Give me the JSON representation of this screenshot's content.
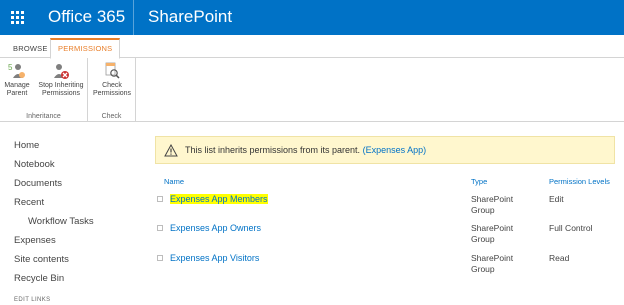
{
  "suite": {
    "brand": "Office 365",
    "app": "SharePoint",
    "icons": {
      "waffle": "app-launcher-icon"
    },
    "color": "#0072c6"
  },
  "ribbon": {
    "tabs": [
      {
        "label": "BROWSE"
      },
      {
        "label": "PERMISSIONS",
        "active": true
      }
    ],
    "accent": "#e97f2a",
    "groups": [
      {
        "label": "Inheritance",
        "buttons": [
          {
            "line1": "Manage",
            "line2": "Parent",
            "icon": "manage-parent-icon"
          },
          {
            "line1": "Stop Inheriting",
            "line2": "Permissions",
            "icon": "stop-inheriting-icon"
          }
        ]
      },
      {
        "label": "Check",
        "buttons": [
          {
            "line1": "Check",
            "line2": "Permissions",
            "icon": "check-permissions-icon"
          }
        ]
      }
    ]
  },
  "leftnav": {
    "items": [
      {
        "label": "Home"
      },
      {
        "label": "Notebook"
      },
      {
        "label": "Documents"
      },
      {
        "label": "Recent"
      },
      {
        "label": "Workflow Tasks"
      },
      {
        "label": "Expenses"
      },
      {
        "label": "Site contents"
      },
      {
        "label": "Recycle Bin"
      }
    ],
    "edit_links": "EDIT LINKS"
  },
  "banner": {
    "text": "This list inherits permissions from its parent.",
    "link": "(Expenses App)",
    "icon": "warning-icon",
    "bg": "#fff7ce"
  },
  "table": {
    "headers": {
      "name": "Name",
      "type": "Type",
      "perm": "Permission Levels"
    },
    "rows": [
      {
        "name": "Expenses App Members",
        "type1": "SharePoint",
        "type2": "Group",
        "perm": "Edit",
        "highlight": true
      },
      {
        "name": "Expenses App Owners",
        "type1": "SharePoint",
        "type2": "Group",
        "perm": "Full Control"
      },
      {
        "name": "Expenses App Visitors",
        "type1": "SharePoint",
        "type2": "Group",
        "perm": "Read"
      }
    ]
  }
}
